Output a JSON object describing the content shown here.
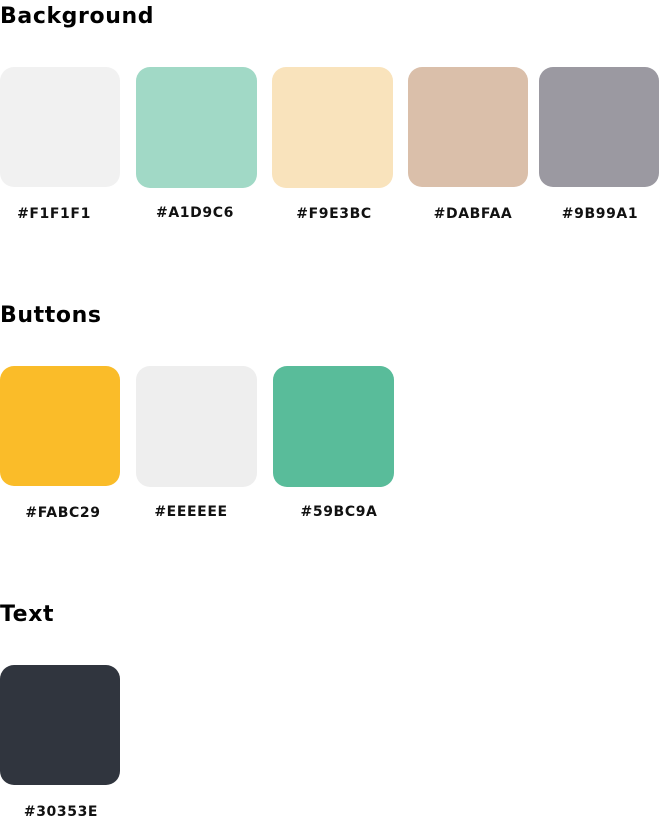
{
  "sections": [
    {
      "title": "Background",
      "swatches": [
        {
          "hex": "#F1F1F1",
          "color": "#F1F1F1"
        },
        {
          "hex": "#A1D9C6",
          "color": "#A1D9C6"
        },
        {
          "hex": "#F9E3BC",
          "color": "#F9E3BC"
        },
        {
          "hex": "#DABFAA",
          "color": "#DABFAA"
        },
        {
          "hex": "#9B99A1",
          "color": "#9B99A1"
        }
      ]
    },
    {
      "title": "Buttons",
      "swatches": [
        {
          "hex": "#FABC29",
          "color": "#FABC29"
        },
        {
          "hex": "#EEEEEE",
          "color": "#EEEEEE"
        },
        {
          "hex": "#59BC9A",
          "color": "#59BC9A"
        }
      ]
    },
    {
      "title": "Text",
      "swatches": [
        {
          "hex": "#30353E",
          "color": "#30353E"
        }
      ]
    }
  ]
}
